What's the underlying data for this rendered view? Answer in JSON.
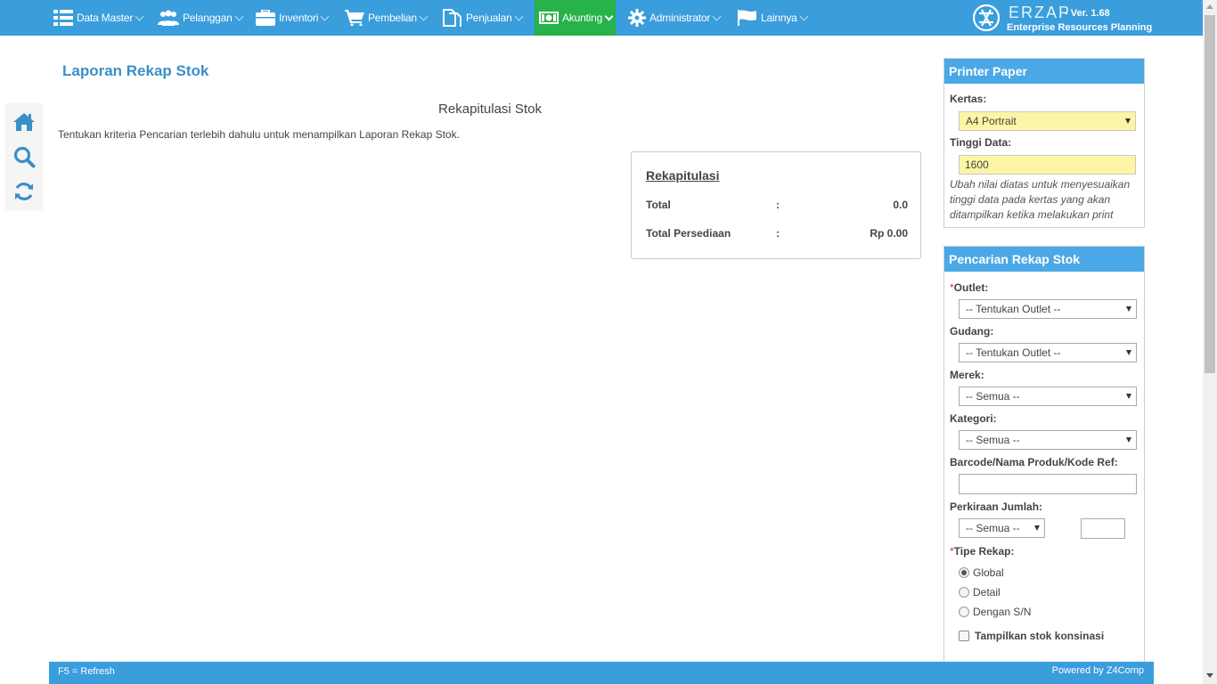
{
  "nav": {
    "items": [
      {
        "label": "Data Master",
        "icon": "list-icon"
      },
      {
        "label": "Pelanggan",
        "icon": "users-icon"
      },
      {
        "label": "Inventori",
        "icon": "briefcase-icon"
      },
      {
        "label": "Pembelian",
        "icon": "cart-icon"
      },
      {
        "label": "Penjualan",
        "icon": "document-icon"
      },
      {
        "label": "Akunting",
        "icon": "money-icon",
        "active": true
      },
      {
        "label": "Administrator",
        "icon": "gear-icon"
      },
      {
        "label": "Lainnya",
        "icon": "flag-icon"
      }
    ],
    "active_color": "#27b24a",
    "bar_color": "#3a9ddc"
  },
  "brand": {
    "name": "ERZAP",
    "version": "- Ver. 1.68",
    "tagline": "Enterprise Resources Planning"
  },
  "sidebar": {
    "tools": [
      "home-icon",
      "search-icon",
      "refresh-icon"
    ]
  },
  "main": {
    "page_title": "Laporan Rekap Stok",
    "report_title": "Rekapitulasi Stok",
    "info_text": "Tentukan kriteria Pencarian terlebih dahulu untuk menampilkan Laporan Rekap Stok.",
    "recap": {
      "heading": "Rekapitulasi",
      "rows": [
        {
          "label": "Total",
          "colon": ":",
          "value": "0.0"
        },
        {
          "label": "Total Persediaan",
          "colon": ":",
          "value": "Rp 0.00"
        }
      ]
    }
  },
  "printer": {
    "heading": "Printer Paper",
    "kertas_label": "Kertas:",
    "kertas_value": "A4 Portrait",
    "tinggi_label": "Tinggi Data:",
    "tinggi_value": "1600",
    "hint": "Ubah nilai diatas untuk menyesuaikan tinggi data pada kertas yang akan ditampilkan ketika melakukan print"
  },
  "search": {
    "heading": "Pencarian Rekap Stok",
    "required_mark": "*",
    "outlet_label": "Outlet:",
    "outlet_value": "-- Tentukan Outlet --",
    "gudang_label": "Gudang:",
    "gudang_value": "-- Tentukan Outlet --",
    "merek_label": "Merek:",
    "merek_value": "-- Semua --",
    "kategori_label": "Kategori:",
    "kategori_value": "-- Semua --",
    "barcode_label": "Barcode/Nama Produk/Kode Ref:",
    "barcode_value": "",
    "jumlah_label": "Perkiraan Jumlah:",
    "jumlah_op_value": "-- Semua --",
    "jumlah_value": "",
    "tipe_label": "Tipe Rekap:",
    "tipe_options": [
      {
        "label": "Global",
        "checked": true
      },
      {
        "label": "Detail",
        "checked": false
      },
      {
        "label": "Dengan S/N",
        "checked": false
      }
    ],
    "konsinasi_label": "Tampilkan stok konsinasi"
  },
  "footer": {
    "left": "F5 = Refresh",
    "right": "Powered by Z4Comp"
  }
}
